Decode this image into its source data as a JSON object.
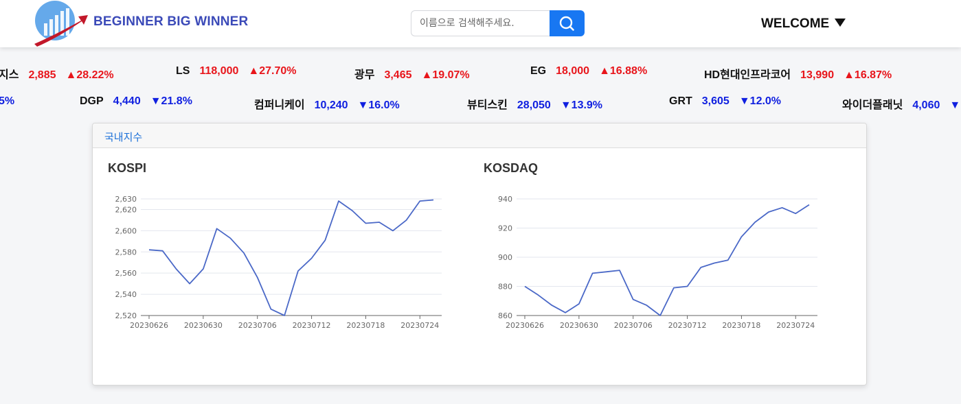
{
  "header": {
    "brand": "BEGINNER BIG WINNER",
    "search_placeholder": "이름으로 검색해주세요.",
    "welcome": "WELCOME",
    "icons": {
      "logo": "rising-bars-arrow-logo",
      "search": "search-icon",
      "caret": "caret-down-icon"
    }
  },
  "colors": {
    "up": "#e8151b",
    "down": "#1020e0",
    "accent": "#1877f2",
    "brand": "#3b4ab8",
    "line": "#4a68c7"
  },
  "ticker_up": [
    {
      "name": "지스",
      "price": "2,885",
      "change": "▲28.22%"
    },
    {
      "name": "LS",
      "price": "118,000",
      "change": "▲27.70%"
    },
    {
      "name": "광무",
      "price": "3,465",
      "change": "▲19.07%"
    },
    {
      "name": "EG",
      "price": "18,000",
      "change": "▲16.88%"
    },
    {
      "name": "HD현대인프라코어",
      "price": "13,990",
      "change": "▲16.87%"
    }
  ],
  "ticker_down": [
    {
      "name": "",
      "price": "",
      "change": "5%"
    },
    {
      "name": "DGP",
      "price": "4,440",
      "change": "▼21.8%"
    },
    {
      "name": "컴퍼니케이",
      "price": "10,240",
      "change": "▼16.0%"
    },
    {
      "name": "뷰티스킨",
      "price": "28,050",
      "change": "▼13.9%"
    },
    {
      "name": "GRT",
      "price": "3,605",
      "change": "▼12.0%"
    },
    {
      "name": "와이더플래닛",
      "price": "4,060",
      "change": "▼"
    }
  ],
  "panel": {
    "tab_label": "국내지수"
  },
  "chart_data": [
    {
      "type": "line",
      "title": "KOSPI",
      "x": [
        "20230626",
        "20230627",
        "20230628",
        "20230629",
        "20230630",
        "20230703",
        "20230704",
        "20230705",
        "20230706",
        "20230707",
        "20230710",
        "20230711",
        "20230712",
        "20230713",
        "20230714",
        "20230717",
        "20230718",
        "20230719",
        "20230720",
        "20230721",
        "20230724",
        "20230725"
      ],
      "series": [
        {
          "values": [
            2582,
            2581,
            2564,
            2550,
            2564,
            2602,
            2593,
            2579,
            2556,
            2526,
            2520,
            2562,
            2574,
            2591,
            2628,
            2619,
            2607,
            2608,
            2600,
            2610,
            2628,
            2629
          ]
        }
      ],
      "x_tick_labels": [
        "20230626",
        "20230630",
        "20230706",
        "20230712",
        "20230718",
        "20230724"
      ],
      "y_tick_labels": [
        "2,520",
        "2,540",
        "2,560",
        "2,580",
        "2,600",
        "2,620",
        "2,630"
      ],
      "y_ticks": [
        2520,
        2540,
        2560,
        2580,
        2600,
        2620,
        2630
      ],
      "ylim": [
        2520,
        2630
      ],
      "grid": true
    },
    {
      "type": "line",
      "title": "KOSDAQ",
      "x": [
        "20230626",
        "20230627",
        "20230628",
        "20230629",
        "20230630",
        "20230703",
        "20230704",
        "20230705",
        "20230706",
        "20230707",
        "20230710",
        "20230711",
        "20230712",
        "20230713",
        "20230714",
        "20230717",
        "20230718",
        "20230719",
        "20230720",
        "20230721",
        "20230724",
        "20230725"
      ],
      "series": [
        {
          "values": [
            880,
            874,
            867,
            862,
            868,
            889,
            890,
            891,
            871,
            867,
            860,
            879,
            880,
            893,
            896,
            898,
            914,
            924,
            931,
            934,
            930,
            936
          ]
        }
      ],
      "x_tick_labels": [
        "20230626",
        "20230630",
        "20230706",
        "20230712",
        "20230718",
        "20230724"
      ],
      "y_tick_labels": [
        "860",
        "880",
        "900",
        "920",
        "940"
      ],
      "y_ticks": [
        860,
        880,
        900,
        920,
        940
      ],
      "ylim": [
        860,
        940
      ],
      "grid": true
    }
  ]
}
